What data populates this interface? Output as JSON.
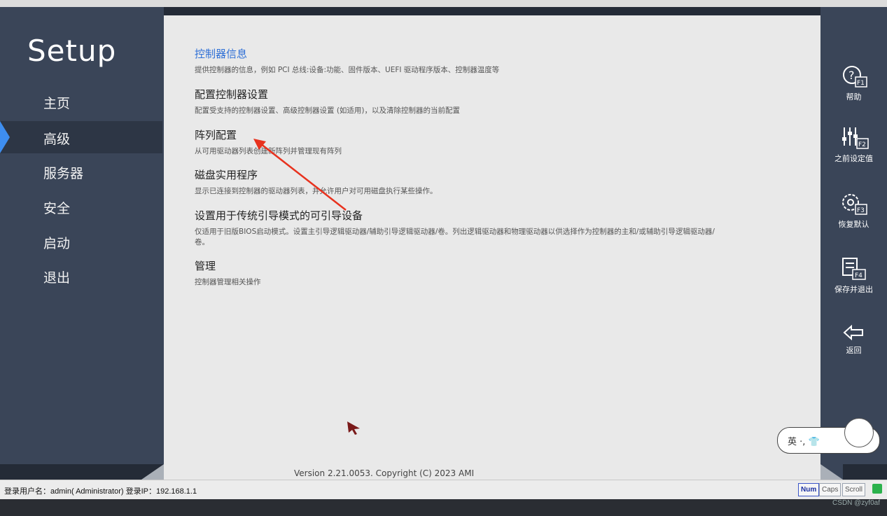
{
  "app": {
    "logo": "Setup"
  },
  "nav": {
    "items": [
      {
        "label": "主页",
        "active": false
      },
      {
        "label": "高级",
        "active": true
      },
      {
        "label": "服务器",
        "active": false
      },
      {
        "label": "安全",
        "active": false
      },
      {
        "label": "启动",
        "active": false
      },
      {
        "label": "退出",
        "active": false
      }
    ]
  },
  "main": {
    "items": [
      {
        "title": "控制器信息",
        "desc": "提供控制器的信息，例如 PCI 总线:设备:功能、固件版本、UEFI 驱动程序版本、控制器温度等"
      },
      {
        "title": "配置控制器设置",
        "desc": "配置受支持的控制器设置、高级控制器设置 (如适用)，以及清除控制器的当前配置"
      },
      {
        "title": "阵列配置",
        "desc": "从可用驱动器列表创建新阵列并管理现有阵列"
      },
      {
        "title": "磁盘实用程序",
        "desc": "显示已连接到控制器的驱动器列表，并允许用户对可用磁盘执行某些操作。"
      },
      {
        "title": "设置用于传统引导模式的可引导设备",
        "desc": "仅适用于旧版BIOS启动模式。设置主引导逻辑驱动器/辅助引导逻辑驱动器/卷。列出逻辑驱动器和物理驱动器以供选择作为控制器的主和/或辅助引导逻辑驱动器/卷。"
      },
      {
        "title": "管理",
        "desc": "控制器管理相关操作"
      }
    ],
    "version": "Version 2.21.0053. Copyright (C) 2023 AMI"
  },
  "right": {
    "buttons": [
      {
        "icon": "help-icon",
        "key": "F1",
        "label": "帮助"
      },
      {
        "icon": "sliders-icon",
        "key": "F2",
        "label": "之前设定值"
      },
      {
        "icon": "gear-icon",
        "key": "F3",
        "label": "恢复默认"
      },
      {
        "icon": "save-icon",
        "key": "F4",
        "label": "保存并退出"
      },
      {
        "icon": "back-arrow-icon",
        "key": "",
        "label": "返回"
      }
    ]
  },
  "status": {
    "user_info": "登录用户名：admin( Administrator)   登录IP：192.168.1.1",
    "keys": {
      "num": "Num",
      "caps": "Caps",
      "scroll": "Scroll"
    }
  },
  "ime": {
    "text": "英 ·, 👕"
  },
  "watermark": "CSDN @zyf0af",
  "colors": {
    "accent": "#3e8ef0",
    "link": "#2e6fd6",
    "panel": "#3a4558",
    "content_bg": "#e9e9e9"
  }
}
